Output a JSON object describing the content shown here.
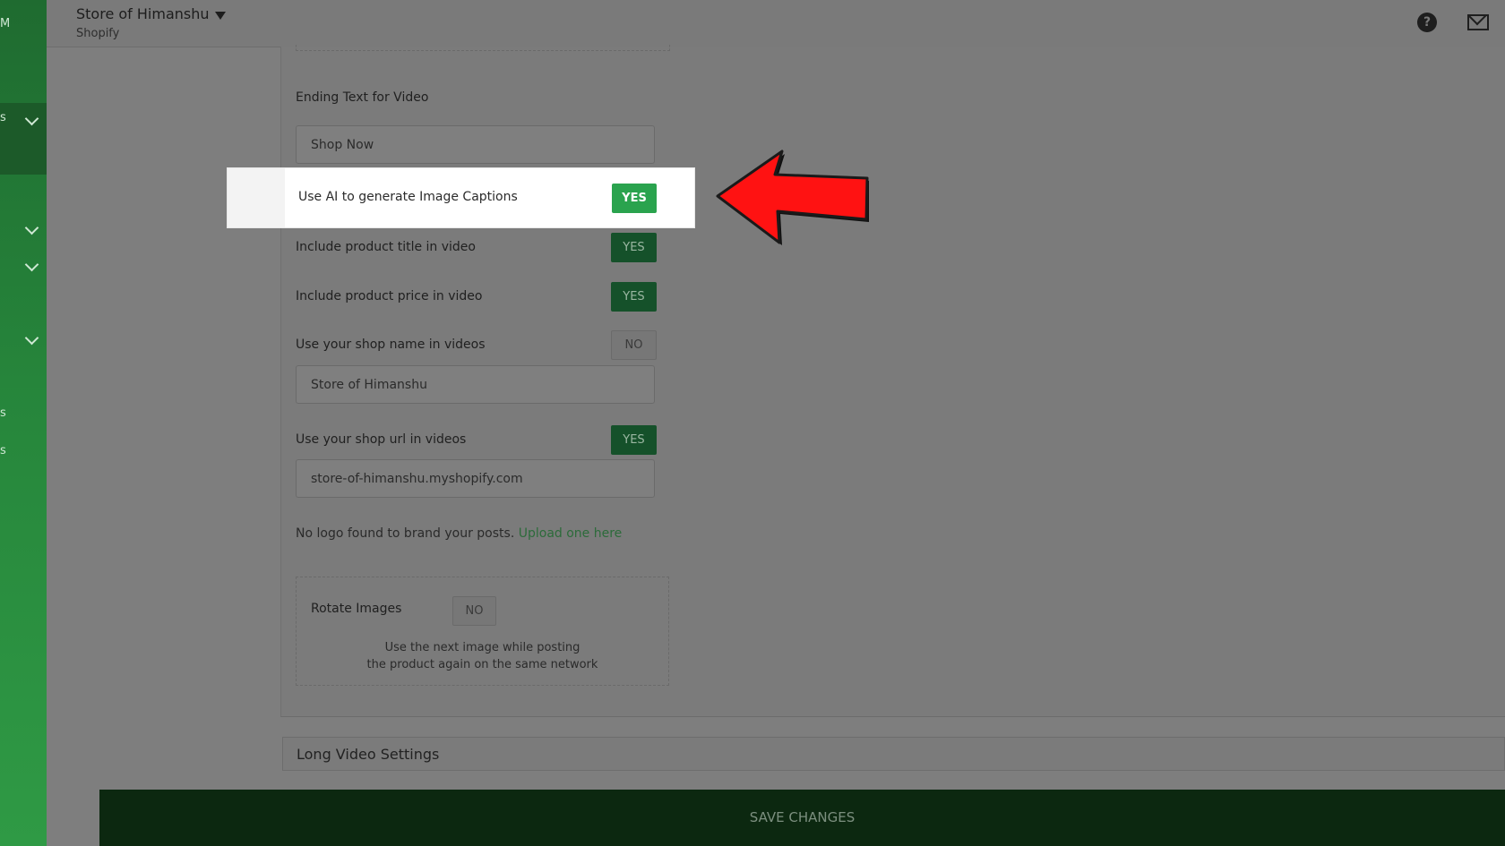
{
  "sidebar": {
    "fragments": [
      "M",
      "s",
      "s",
      "s"
    ]
  },
  "header": {
    "store_name": "Store of Himanshu",
    "platform": "Shopify",
    "help_icon_glyph": "?"
  },
  "form": {
    "ending_text_label": "Ending Text for Video",
    "ending_text_value": "Shop Now",
    "ai_captions_label": "Use AI to generate Image Captions",
    "ai_captions_value": "YES",
    "product_title_label": "Include product title in video",
    "product_title_value": "YES",
    "product_price_label": "Include product price in video",
    "product_price_value": "YES",
    "shop_name_label": "Use your shop name in videos",
    "shop_name_value": "NO",
    "shop_name_field": "Store of  Himanshu",
    "shop_url_label": "Use your shop url in videos",
    "shop_url_value": "YES",
    "shop_url_field": "store-of-himanshu.myshopify.com",
    "logo_note": "No logo found to brand your posts.",
    "logo_link": "Upload one here",
    "rotate_label": "Rotate Images",
    "rotate_value": "NO",
    "rotate_help_line1": "Use the next image while posting",
    "rotate_help_line2": "the product again on the same network"
  },
  "sections": {
    "long_video": "Long Video Settings"
  },
  "footer": {
    "save_label": "SAVE CHANGES"
  },
  "colors": {
    "sidebar_green": "#26853b",
    "yes_active": "#2aa34e",
    "arrow_red": "#ff0000",
    "save_bar": "#0c2810"
  }
}
